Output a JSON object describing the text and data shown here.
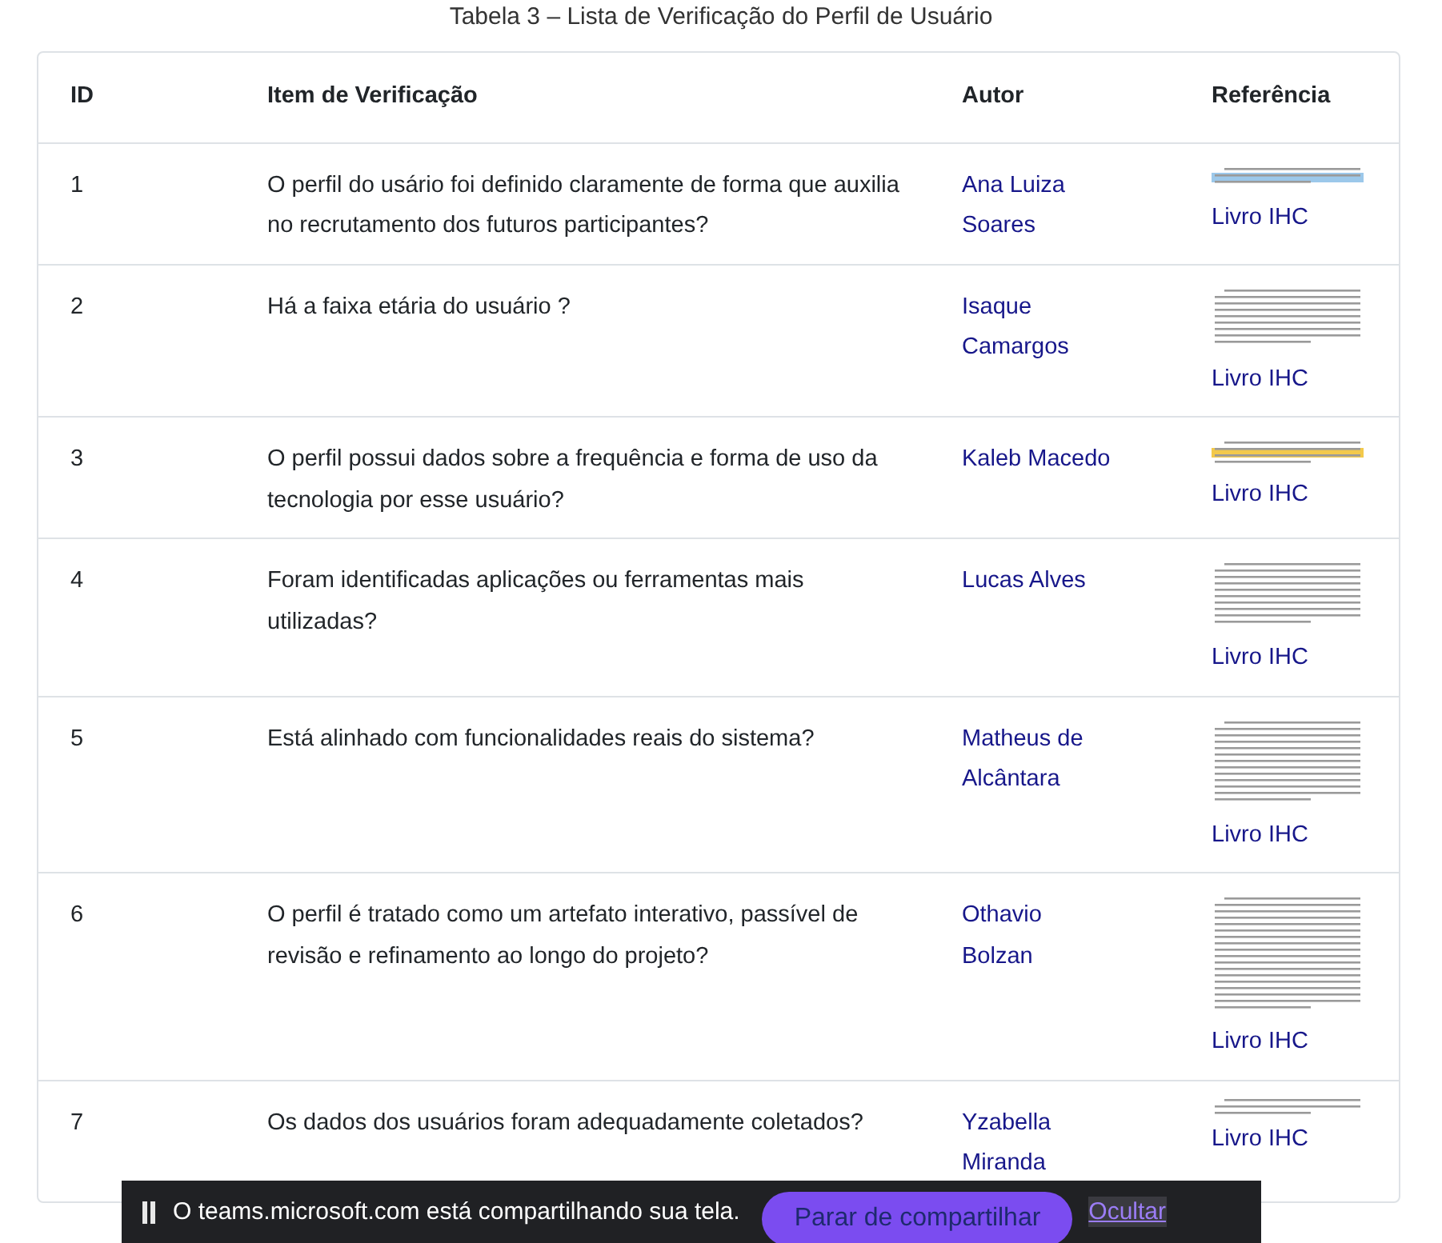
{
  "caption": "Tabela 3 – Lista de Verificação do Perfil de Usuário",
  "table": {
    "columns": [
      "ID",
      "Item de Verificação",
      "Autor",
      "Referência"
    ],
    "rows": [
      {
        "id": "1",
        "item": "O perfil do usário foi definido claramente de forma que auxilia no recrutamento dos futuros participantes?",
        "author": "Ana Luiza Soares",
        "reference": "Livro IHC"
      },
      {
        "id": "2",
        "item": "Há a faixa etária do usuário ?",
        "author": "Isaque Camargos",
        "reference": "Livro IHC"
      },
      {
        "id": "3",
        "item": "O perfil possui dados sobre a frequência e forma de uso da tecnologia por esse usuário?",
        "author": "Kaleb Macedo",
        "reference": "Livro IHC"
      },
      {
        "id": "4",
        "item": "Foram identificadas aplicações ou ferramentas mais utilizadas?",
        "author": "Lucas Alves",
        "reference": "Livro IHC"
      },
      {
        "id": "5",
        "item": "Está alinhado com funcionalidades reais do sistema?",
        "author": "Matheus de Alcântara",
        "reference": "Livro IHC"
      },
      {
        "id": "6",
        "item": "O perfil é tratado como um artefato interativo, passível de revisão e refinamento ao longo do projeto?",
        "author": "Othavio Bolzan",
        "reference": "Livro IHC"
      },
      {
        "id": "7",
        "item": "Os dados dos usuários foram adequadamente coletados?",
        "author": "Yzabella Miranda",
        "reference": "Livro IHC"
      }
    ]
  },
  "share_bar": {
    "message": "O teams.microsoft.com está compartilhando sua tela.",
    "stop_button": "Parar de compartilhar",
    "hide_link": "Ocultar"
  }
}
